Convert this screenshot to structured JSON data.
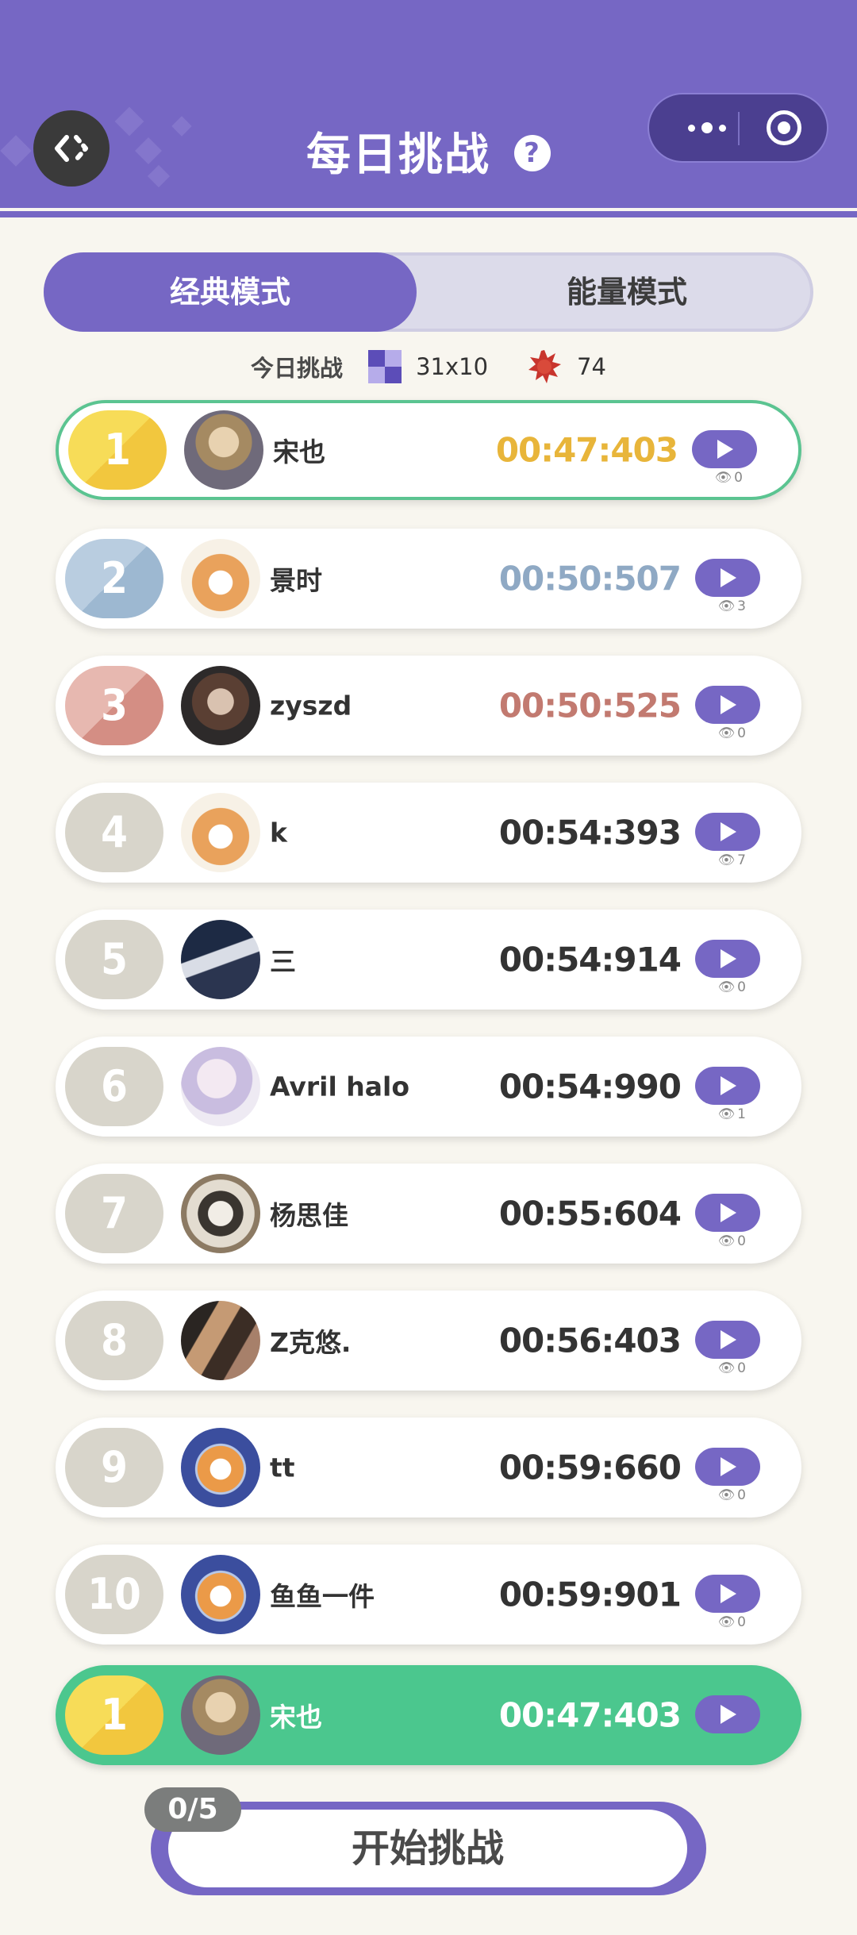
{
  "header": {
    "title": "每日挑战",
    "help_icon": "?"
  },
  "tabs": [
    {
      "label": "经典模式",
      "active": true
    },
    {
      "label": "能量模式",
      "active": false
    }
  ],
  "info": {
    "label": "今日挑战",
    "grid_size": "31x10",
    "mine_count": "74"
  },
  "leaderboard": [
    {
      "rank": "1",
      "name": "宋也",
      "time": "00:47:403",
      "views": "0"
    },
    {
      "rank": "2",
      "name": "景时",
      "time": "00:50:507",
      "views": "3"
    },
    {
      "rank": "3",
      "name": "zyszd",
      "time": "00:50:525",
      "views": "0"
    },
    {
      "rank": "4",
      "name": "k",
      "time": "00:54:393",
      "views": "7"
    },
    {
      "rank": "5",
      "name": "三",
      "time": "00:54:914",
      "views": "0"
    },
    {
      "rank": "6",
      "name": "Avril halo",
      "time": "00:54:990",
      "views": "1"
    },
    {
      "rank": "7",
      "name": "杨思佳",
      "time": "00:55:604",
      "views": "0"
    },
    {
      "rank": "8",
      "name": "Z克悠.",
      "time": "00:56:403",
      "views": "0"
    },
    {
      "rank": "9",
      "name": "tt",
      "time": "00:59:660",
      "views": "0"
    },
    {
      "rank": "10",
      "name": "鱼鱼一件",
      "time": "00:59:901",
      "views": "0"
    }
  ],
  "my_entry": {
    "rank": "1",
    "name": "宋也",
    "time": "00:47:403"
  },
  "start": {
    "label": "开始挑战",
    "attempts": "0/5"
  },
  "colors": {
    "primary": "#7667c4",
    "gold": "#e8b53a",
    "silver": "#8fa9c4",
    "bronze": "#c27a70",
    "mine_row": "#4bc78e"
  }
}
